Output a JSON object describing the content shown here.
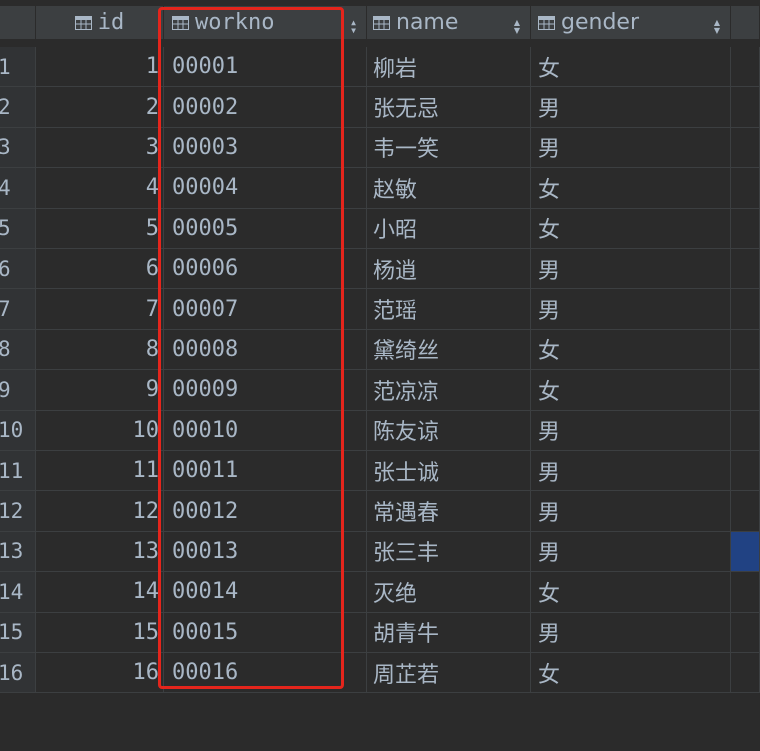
{
  "columns": [
    {
      "key": "id",
      "label": "id"
    },
    {
      "key": "workno",
      "label": "workno"
    },
    {
      "key": "name",
      "label": "name"
    },
    {
      "key": "gender",
      "label": "gender"
    }
  ],
  "rows": [
    {
      "rn": "1",
      "id": "1",
      "workno": "00001",
      "name": "柳岩",
      "gender": "女"
    },
    {
      "rn": "2",
      "id": "2",
      "workno": "00002",
      "name": "张无忌",
      "gender": "男"
    },
    {
      "rn": "3",
      "id": "3",
      "workno": "00003",
      "name": "韦一笑",
      "gender": "男"
    },
    {
      "rn": "4",
      "id": "4",
      "workno": "00004",
      "name": "赵敏",
      "gender": "女"
    },
    {
      "rn": "5",
      "id": "5",
      "workno": "00005",
      "name": "小昭",
      "gender": "女"
    },
    {
      "rn": "6",
      "id": "6",
      "workno": "00006",
      "name": "杨逍",
      "gender": "男"
    },
    {
      "rn": "7",
      "id": "7",
      "workno": "00007",
      "name": "范瑶",
      "gender": "男"
    },
    {
      "rn": "8",
      "id": "8",
      "workno": "00008",
      "name": "黛绮丝",
      "gender": "女"
    },
    {
      "rn": "9",
      "id": "9",
      "workno": "00009",
      "name": "范凉凉",
      "gender": "女"
    },
    {
      "rn": "10",
      "id": "10",
      "workno": "00010",
      "name": "陈友谅",
      "gender": "男"
    },
    {
      "rn": "11",
      "id": "11",
      "workno": "00011",
      "name": "张士诚",
      "gender": "男"
    },
    {
      "rn": "12",
      "id": "12",
      "workno": "00012",
      "name": "常遇春",
      "gender": "男"
    },
    {
      "rn": "13",
      "id": "13",
      "workno": "00013",
      "name": "张三丰",
      "gender": "男"
    },
    {
      "rn": "14",
      "id": "14",
      "workno": "00014",
      "name": "灭绝",
      "gender": "女"
    },
    {
      "rn": "15",
      "id": "15",
      "workno": "00015",
      "name": "胡青牛",
      "gender": "男"
    },
    {
      "rn": "16",
      "id": "16",
      "workno": "00016",
      "name": "周芷若",
      "gender": "女"
    }
  ],
  "selected_row_index": 12,
  "colors": {
    "background": "#2b2b2b",
    "header": "#3c3f41",
    "selection": "#214283",
    "highlight_box": "#e4251c"
  },
  "icons": {
    "column_header": "table-column-icon",
    "sort": "sort-arrows-icon"
  }
}
